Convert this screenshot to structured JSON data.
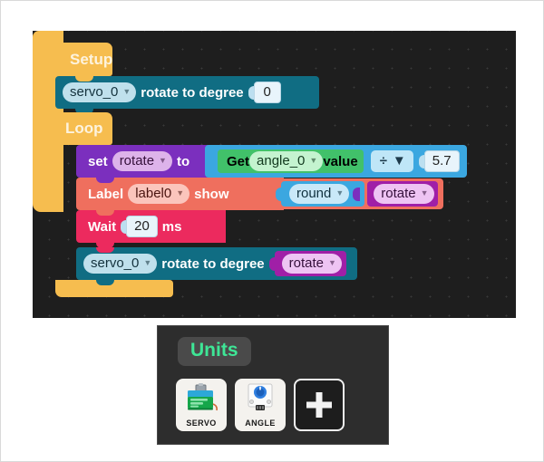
{
  "canvas": {
    "background_color": "#1e1e1e",
    "grid_dot_color": "#3a3a3a"
  },
  "program": {
    "setup": {
      "label": "Setup",
      "color": "#f6bd4f",
      "statements": [
        {
          "id": "servo-top",
          "color": "#106d83",
          "device": "servo_0",
          "action": "rotate to degree",
          "value": "0"
        }
      ]
    },
    "loop": {
      "label": "Loop",
      "color": "#f6bd4f",
      "statements": [
        {
          "id": "set-rotate",
          "color": "#7b2fbe",
          "set_label": "set",
          "variable": "rotate",
          "to_label": "to",
          "expression": {
            "color": "#3ba7e0",
            "get_label": "Get",
            "sensor": "angle_0",
            "value_label": "value",
            "operator": "÷",
            "operand": "5.7"
          }
        },
        {
          "id": "label-row",
          "color": "#ef6f5e",
          "label_word": "Label",
          "target": "label0",
          "show_word": "show",
          "function": "round",
          "argument": "rotate"
        },
        {
          "id": "wait-row",
          "color": "#ec2a5e",
          "wait_label": "Wait",
          "duration": "20",
          "unit_label": "ms"
        },
        {
          "id": "servo-bottom",
          "color": "#106d83",
          "device": "servo_0",
          "action": "rotate to degree",
          "value": "rotate"
        }
      ]
    }
  },
  "units_panel": {
    "title": "Units",
    "title_color": "#3ee696",
    "background_color": "#2d2d2d",
    "items": [
      {
        "label": "SERVO",
        "icon": "servo-motor-icon"
      },
      {
        "label": "ANGLE",
        "icon": "angle-potentiometer-icon"
      }
    ],
    "add_button": {
      "icon": "plus-icon"
    }
  }
}
